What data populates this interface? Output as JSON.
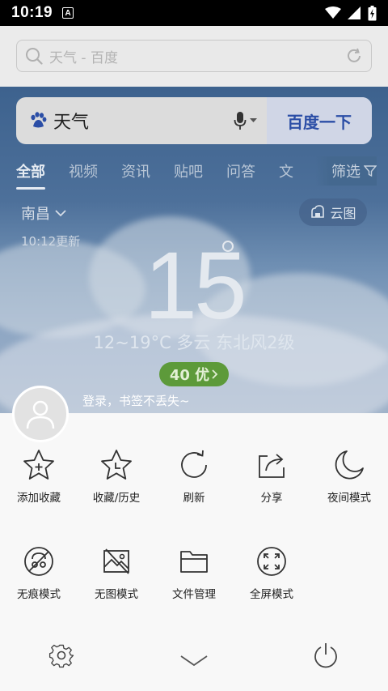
{
  "status_bar": {
    "time": "10:19",
    "notification_icon": "A"
  },
  "address_bar": {
    "url_text": "天气 - 百度"
  },
  "search": {
    "query": "天气",
    "button_label": "百度一下"
  },
  "tabs": [
    "全部",
    "视频",
    "资讯",
    "贴吧",
    "问答",
    "文"
  ],
  "filter_label": "筛选",
  "weather": {
    "city": "南昌",
    "cloud_map": "云图",
    "updated": "10:12更新",
    "temperature": "15",
    "condition": "12~19°C  多云  东北风2级",
    "aqi": "40 优"
  },
  "account": {
    "login_prompt": "登录，书签不丢失~"
  },
  "menu": {
    "row1": [
      {
        "label": "添加收藏",
        "icon": "star-plus-icon"
      },
      {
        "label": "收藏/历史",
        "icon": "star-clock-icon"
      },
      {
        "label": "刷新",
        "icon": "refresh-icon"
      },
      {
        "label": "分享",
        "icon": "share-icon"
      },
      {
        "label": "夜间模式",
        "icon": "moon-icon"
      }
    ],
    "row2": [
      {
        "label": "无痕模式",
        "icon": "incognito-icon"
      },
      {
        "label": "无图模式",
        "icon": "no-image-icon"
      },
      {
        "label": "文件管理",
        "icon": "folder-icon"
      },
      {
        "label": "全屏模式",
        "icon": "fullscreen-icon"
      }
    ]
  },
  "bottom_bar": {
    "settings_icon": "gear-icon",
    "collapse_icon": "chevron-down-icon",
    "exit_icon": "power-icon"
  }
}
